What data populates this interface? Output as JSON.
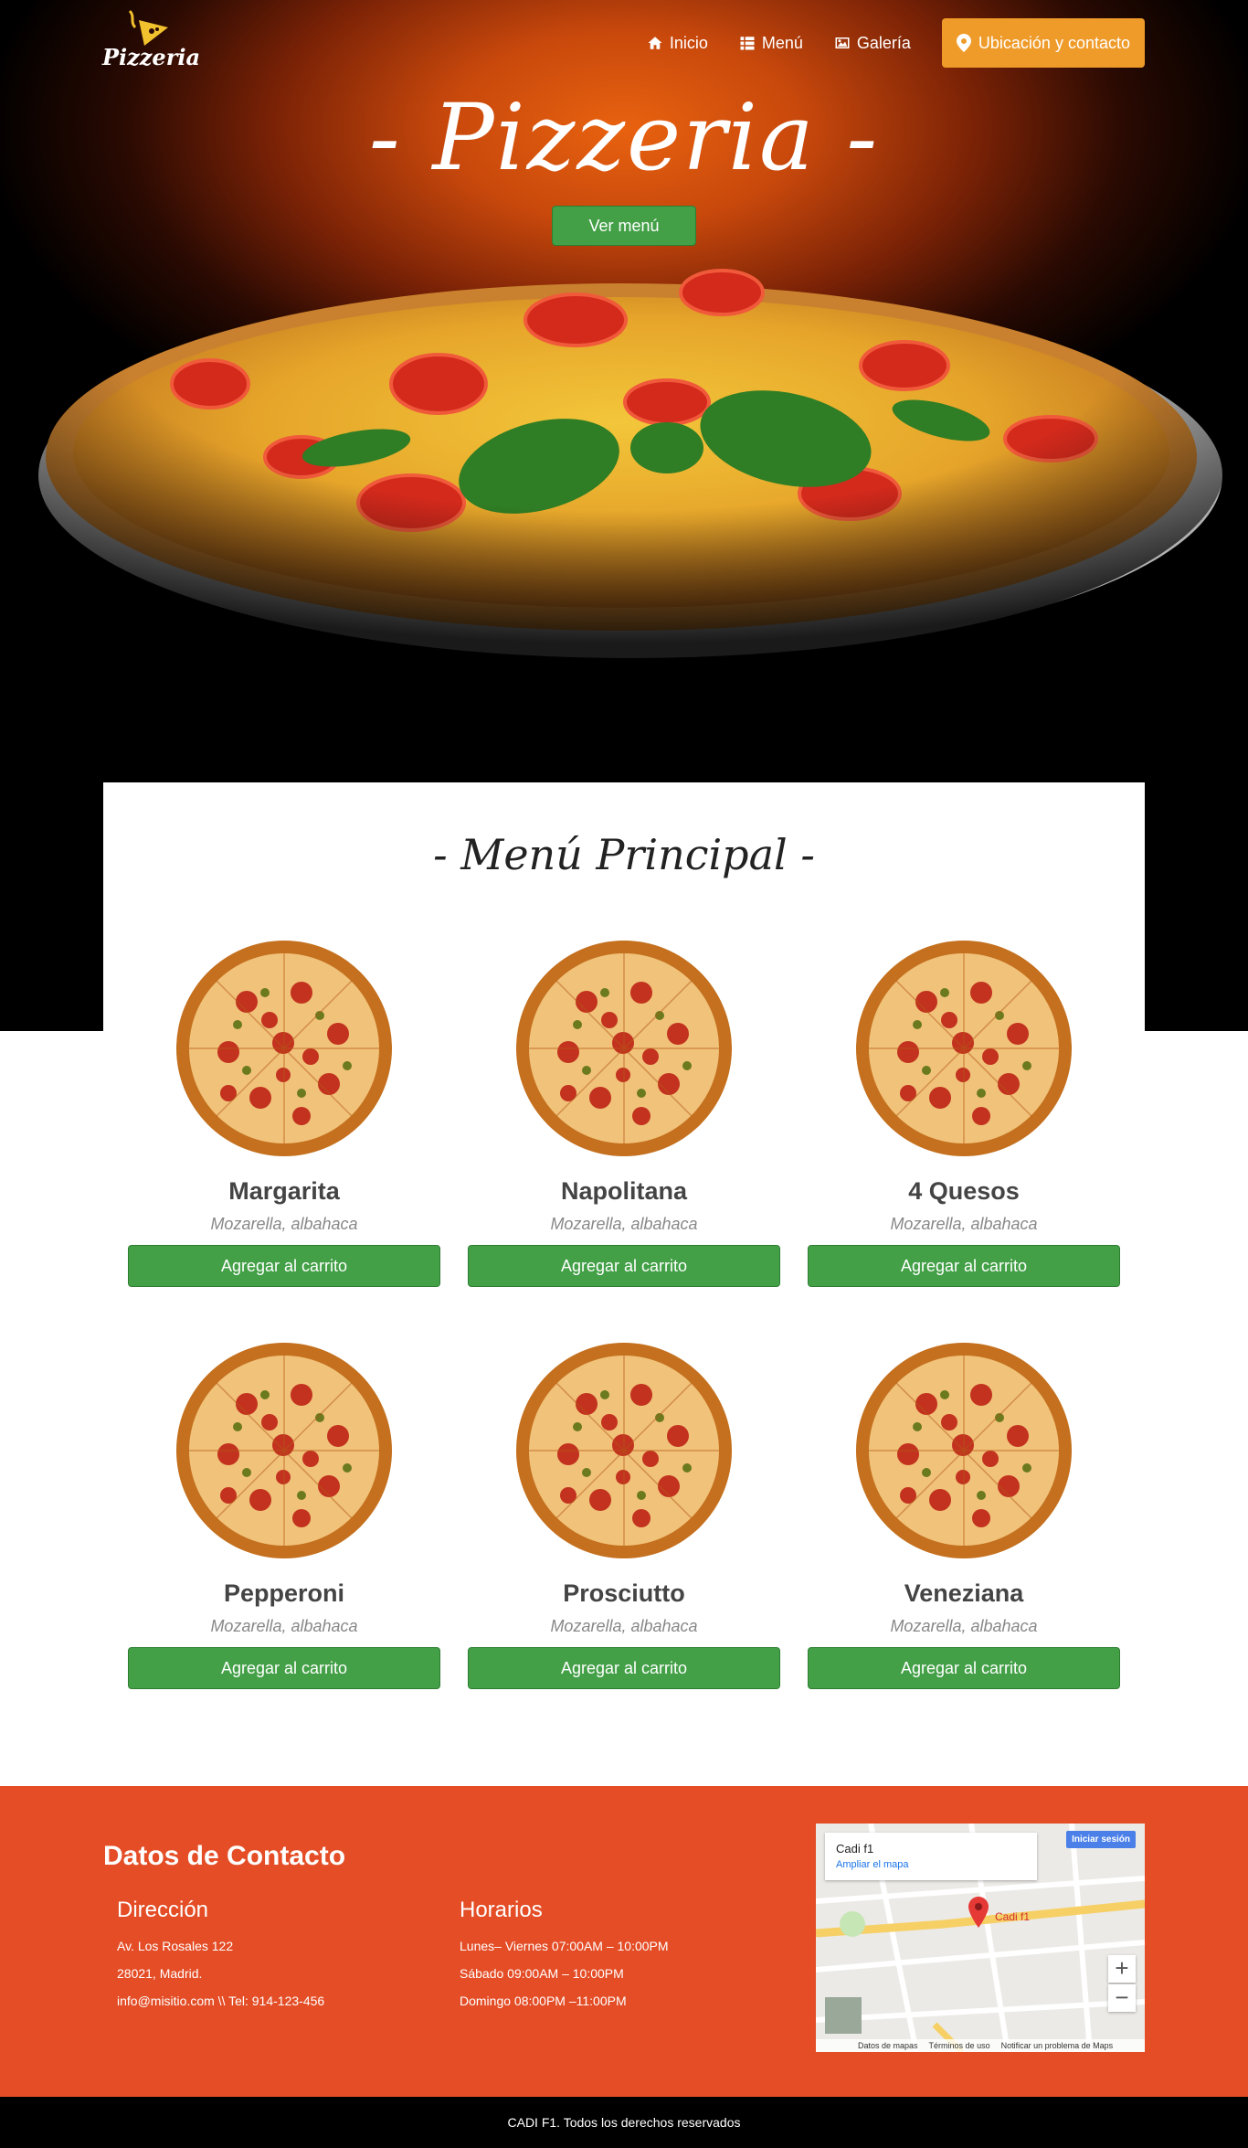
{
  "brand": {
    "logo_text": "Pizzeria"
  },
  "nav": {
    "items": [
      {
        "label": "Inicio",
        "icon": "home-icon"
      },
      {
        "label": "Menú",
        "icon": "list-icon"
      },
      {
        "label": "Galería",
        "icon": "image-icon"
      }
    ],
    "cta": {
      "label": "Ubicación y contacto",
      "icon": "map-marker-icon"
    }
  },
  "hero": {
    "title": "- Pizzeria -",
    "button": "Ver menú"
  },
  "menu": {
    "title": "- Menú Principal -",
    "button_label": "Agregar al carrito",
    "items": [
      {
        "name": "Margarita",
        "desc": "Mozarella, albahaca"
      },
      {
        "name": "Napolitana",
        "desc": "Mozarella, albahaca"
      },
      {
        "name": "4 Quesos",
        "desc": "Mozarella, albahaca"
      },
      {
        "name": "Pepperoni",
        "desc": "Mozarella, albahaca"
      },
      {
        "name": "Prosciutto",
        "desc": "Mozarella, albahaca"
      },
      {
        "name": "Veneziana",
        "desc": "Mozarella, albahaca"
      }
    ]
  },
  "contact": {
    "title": "Datos de Contacto",
    "address": {
      "heading": "Dirección",
      "lines": [
        "Av. Los Rosales 122",
        "28021, Madrid.",
        "info@misitio.com \\\\ Tel: 914-123-456"
      ]
    },
    "hours": {
      "heading": "Horarios",
      "lines": [
        "Lunes– Viernes 07:00AM – 10:00PM",
        "Sábado 09:00AM – 10:00PM",
        "Domingo 08:00PM –11:00PM"
      ]
    },
    "map": {
      "place": "Cadi f1",
      "link": "Ampliar el mapa",
      "signin": "Iniciar sesión",
      "pin_label": "Cadi f1",
      "footer": [
        "Datos de mapas",
        "Términos de uso",
        "Notificar un problema de Maps"
      ]
    }
  },
  "footer": {
    "text": "CADI F1. Todos los derechos reservados"
  },
  "colors": {
    "accent": "#ef9b2a",
    "green": "#43a047",
    "contact_bg": "#e44d26"
  }
}
